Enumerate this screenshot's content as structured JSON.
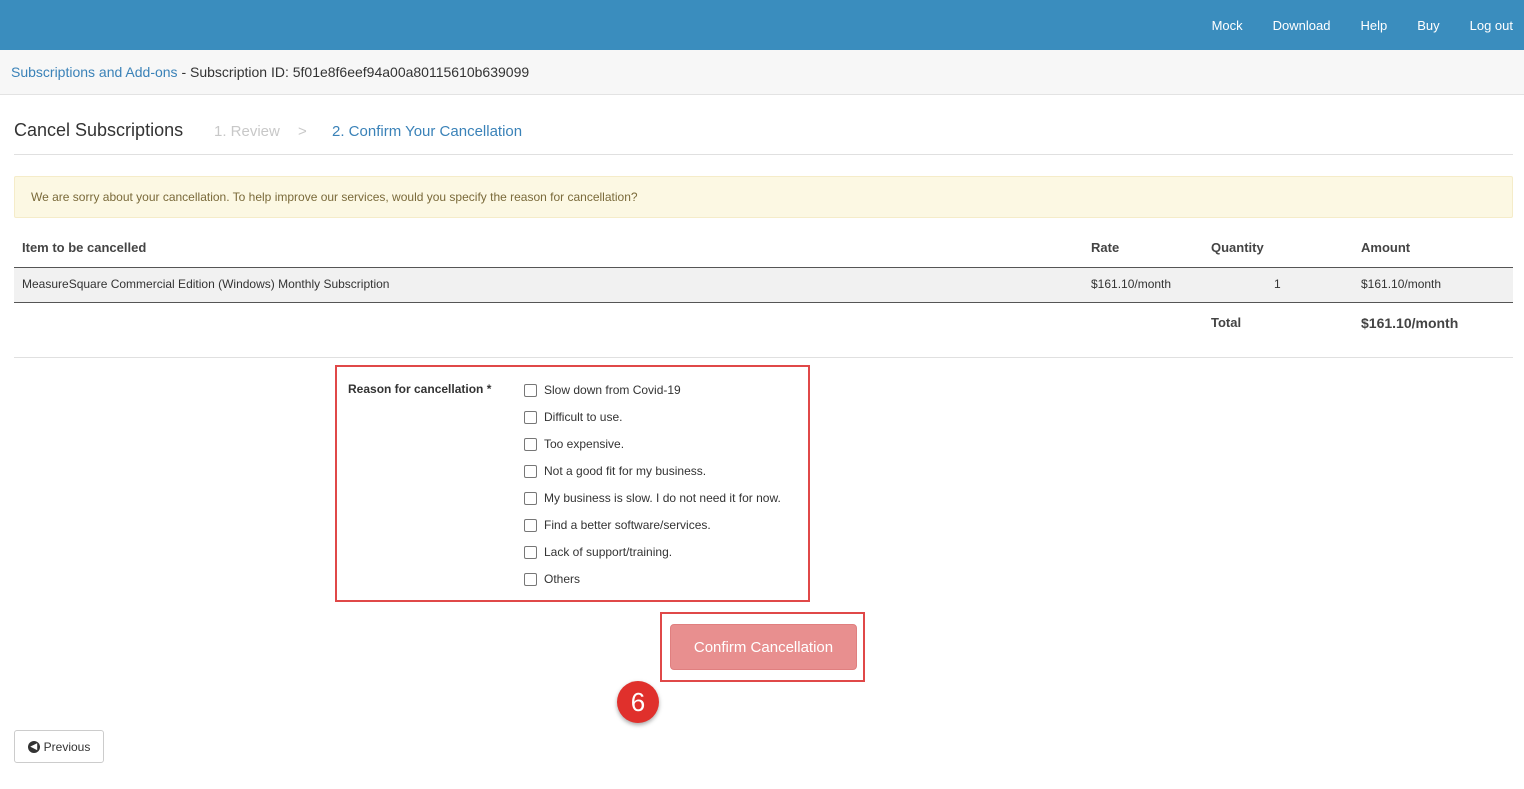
{
  "nav": {
    "items": [
      "Mock",
      "Download",
      "Help",
      "Buy",
      "Log out"
    ]
  },
  "breadcrumb": {
    "link": "Subscriptions and Add-ons",
    "separator": " - ",
    "id_text": "Subscription ID: 5f01e8f6eef94a00a80115610b639099"
  },
  "wizard": {
    "title": "Cancel Subscriptions",
    "step1": "1. Review",
    "separator": ">",
    "step2": "2. Confirm Your Cancellation"
  },
  "alert": {
    "text": "We are sorry about your cancellation. To help improve our services, would you specify the reason for cancellation?"
  },
  "table": {
    "headers": {
      "item": "Item to be cancelled",
      "rate": "Rate",
      "quantity": "Quantity",
      "amount": "Amount"
    },
    "row": {
      "item": "MeasureSquare Commercial Edition (Windows) Monthly Subscription",
      "rate": "$161.10/month",
      "quantity": "1",
      "amount": "$161.10/month"
    },
    "total_label": "Total",
    "total_value": "$161.10/month"
  },
  "reasons": {
    "label": "Reason for cancellation *",
    "options": [
      "Slow down from Covid-19",
      "Difficult to use.",
      "Too expensive.",
      "Not a good fit for my business.",
      "My business is slow. I do not need it for now.",
      "Find a better software/services.",
      "Lack of support/training.",
      "Others"
    ]
  },
  "confirm_button": "Confirm Cancellation",
  "step_badge": "6",
  "previous_button": "Previous",
  "colors": {
    "topbar": "#3a8dbe",
    "link": "#3a82b8",
    "confirm": "#e88f8f",
    "highlight": "#e04848",
    "badge": "#e0302c"
  }
}
